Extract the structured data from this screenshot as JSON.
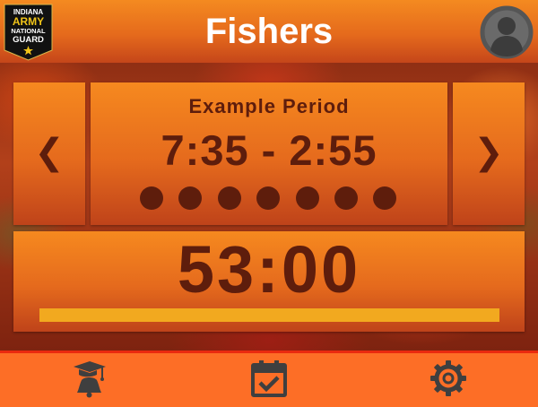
{
  "header": {
    "title": "Fishers",
    "logo_text": [
      "INDIANA",
      "ARMY",
      "NATIONAL",
      "GUARD"
    ],
    "avatar_icon": "user-circle-icon"
  },
  "nav": {
    "prev_label": "❮",
    "next_label": "❯"
  },
  "period": {
    "name": "Example Period",
    "time_range": "7:35 - 2:55",
    "dots": 7
  },
  "timer": {
    "remaining": "53:00",
    "progress": 1.0
  },
  "footer": {
    "items": [
      {
        "name": "classes",
        "icon": "graduation-bell-icon"
      },
      {
        "name": "schedule",
        "icon": "calendar-check-icon"
      },
      {
        "name": "settings",
        "icon": "gear-icon"
      }
    ]
  },
  "colors": {
    "accent": "#fd6e26",
    "panel_text": "#5e1d0c",
    "progress": "#f2a91f",
    "footer_border": "#ea2a0f"
  }
}
